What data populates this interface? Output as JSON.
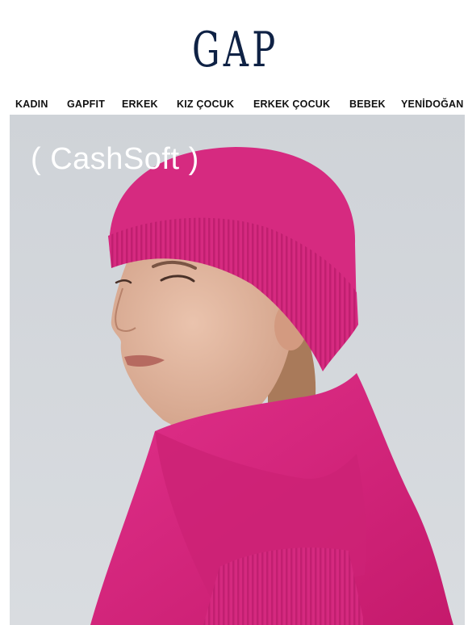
{
  "brand": {
    "logo_text": "GAP",
    "logo_color": "#0f2245"
  },
  "nav": {
    "items": [
      {
        "label": "KADIN"
      },
      {
        "label": "GAPFIT"
      },
      {
        "label": "ERKEK"
      },
      {
        "label": "KIZ ÇOCUK"
      },
      {
        "label": "ERKEK ÇOCUK"
      },
      {
        "label": "BEBEK"
      },
      {
        "label": "YENİDOĞAN"
      }
    ]
  },
  "hero": {
    "title": "( CashSoft )",
    "accent_color": "#d6237a",
    "background_color": "#d2d6db"
  }
}
